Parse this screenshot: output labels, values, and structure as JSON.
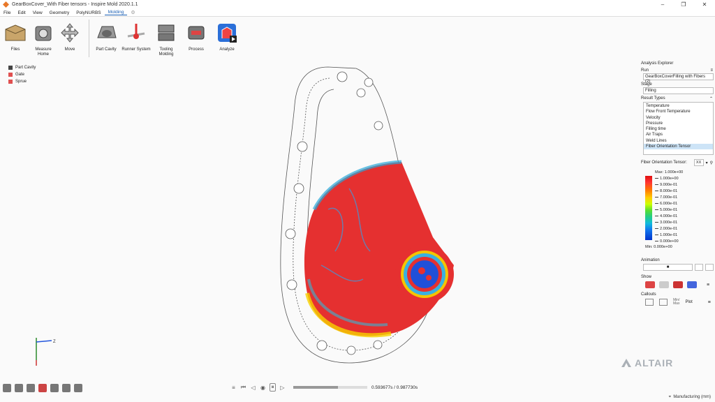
{
  "window": {
    "title": "GearBoxCover_With Fiber tensors - Inspire Mold 2020.1.1"
  },
  "menu": [
    "File",
    "Edit",
    "View",
    "Geometry",
    "PolyNURBS",
    "Molding"
  ],
  "ribbon": {
    "tools": [
      {
        "label": "Files"
      },
      {
        "label": "Measure\nHome"
      },
      {
        "label": "Move"
      },
      {
        "label": "Part Cavity"
      },
      {
        "label": "Runner System"
      },
      {
        "label": "Tooling\nMolding"
      },
      {
        "label": "Process"
      },
      {
        "label": "Analyze"
      }
    ]
  },
  "legend": [
    {
      "label": "Part Cavity",
      "color": "#444444"
    },
    {
      "label": "Gate",
      "color": "#e05050"
    },
    {
      "label": "Sprue",
      "color": "#e05050"
    }
  ],
  "explorer": {
    "title": "Analysis Explorer",
    "run_label": "Run",
    "run_value": "GearBoxCoverFilling with Fibers (2)",
    "stage_label": "Stage",
    "stage_value": "Filling",
    "result_types_label": "Result Types",
    "result_types": [
      "Temperature",
      "Flow Front Temperature",
      "Velocity",
      "Pressure",
      "Filling time",
      "Air Traps",
      "Weld Lines",
      "Fiber Orientation Tensor"
    ],
    "selected_result": "Fiber Orientation Tensor",
    "tensor_label": "Fiber Orientation Tensor:",
    "tensor_component": "XX",
    "colorbar": {
      "max_label": "Max:",
      "max_value": "1.000e+00",
      "min_label": "Min:",
      "min_value": "0.000e+00",
      "ticks": [
        "1.000e+00",
        "9.000e-01",
        "8.000e-01",
        "7.000e-01",
        "6.000e-01",
        "5.000e-01",
        "4.000e-01",
        "3.000e-01",
        "2.000e-01",
        "1.000e-01",
        "0.000e+00"
      ]
    },
    "animation_label": "Animation",
    "show_label": "Show",
    "callouts_label": "Callouts",
    "callout_minmax": "Min/\nMax",
    "callout_plot": "Plot"
  },
  "playback": {
    "time": "0.593677s / 0.987730s",
    "progress": 0.6
  },
  "status": {
    "units": "Manufacturing (mm)"
  },
  "brand": "ALTAIR"
}
